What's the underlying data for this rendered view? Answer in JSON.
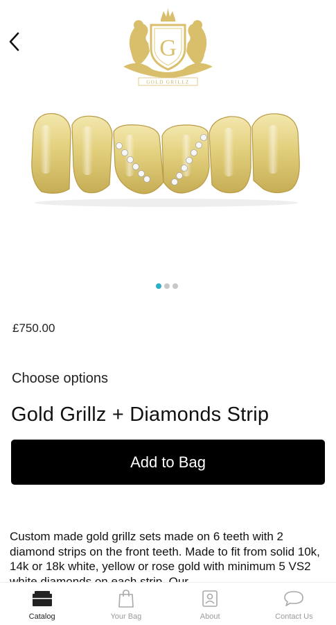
{
  "header": {
    "brand_logo_text": "G",
    "brand_tagline": "GOLD GRILLZ"
  },
  "product": {
    "price": "£750.00",
    "options_label": "Choose options",
    "title": "Gold Grillz + Diamonds Strip",
    "add_to_bag_label": "Add to Bag",
    "description": "Custom made gold grillz sets made on 6 teeth with 2 diamond strips on the front teeth. Made to fit from solid 10k, 14k or 18k white, yellow or rose gold with minimum 5 VS2 white diamonds on each strip. Our",
    "image_count": 3,
    "active_image_index": 1
  },
  "nav": {
    "items": [
      {
        "label": "Catalog",
        "icon": "catalog-icon",
        "active": true
      },
      {
        "label": "Your Bag",
        "icon": "bag-icon",
        "active": false
      },
      {
        "label": "About",
        "icon": "about-icon",
        "active": false
      },
      {
        "label": "Contact Us",
        "icon": "chat-icon",
        "active": false
      }
    ]
  },
  "colors": {
    "accent": "#2bb0c8",
    "gold": "#d8c36a",
    "button_bg": "#000000"
  }
}
